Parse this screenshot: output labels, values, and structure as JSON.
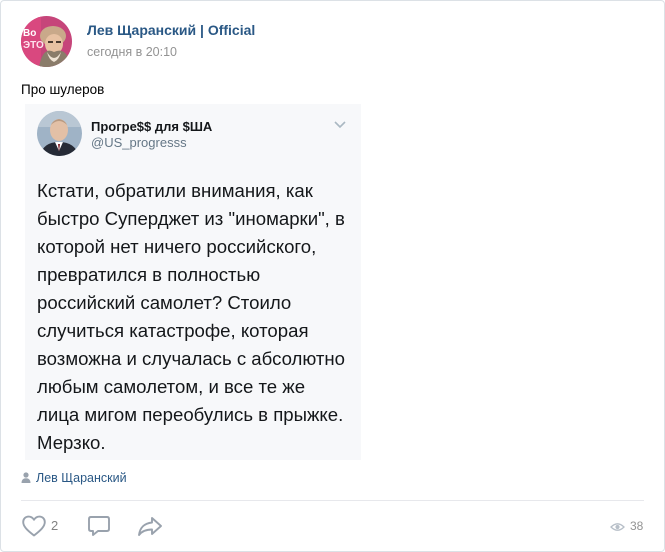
{
  "post": {
    "author": {
      "name": "Лев Щаранский | Official",
      "avatar_icon": "author-avatar"
    },
    "date": "сегодня в 20:10",
    "text": "Про шулеров",
    "embedded_tweet": {
      "display_name": "Прогре$$ для $ША",
      "handle": "@US_progresss",
      "text": "Кстати, обратили внимания, как\nбыстро Суперджет из \"иномарки\", в\nкоторой нет ничего российского,\nпревратился в полностью\nроссийский самолет? Стоило\nслучиться катастрофе, которая\nвозможна и случалась с абсолютно\nлюбым самолетом, и все те же\nлица мигом переобулись в прыжке.\nМерзко."
    },
    "signer": {
      "icon": "user-icon",
      "name": "Лев Щаранский"
    },
    "actions": {
      "like_count": "2",
      "views_count": "38"
    },
    "colors": {
      "link": "#2a5885",
      "meta": "#939393",
      "icon": "#99a2ad",
      "tweet_bg": "#f7f8fa",
      "divider": "#e7e8ec"
    }
  }
}
